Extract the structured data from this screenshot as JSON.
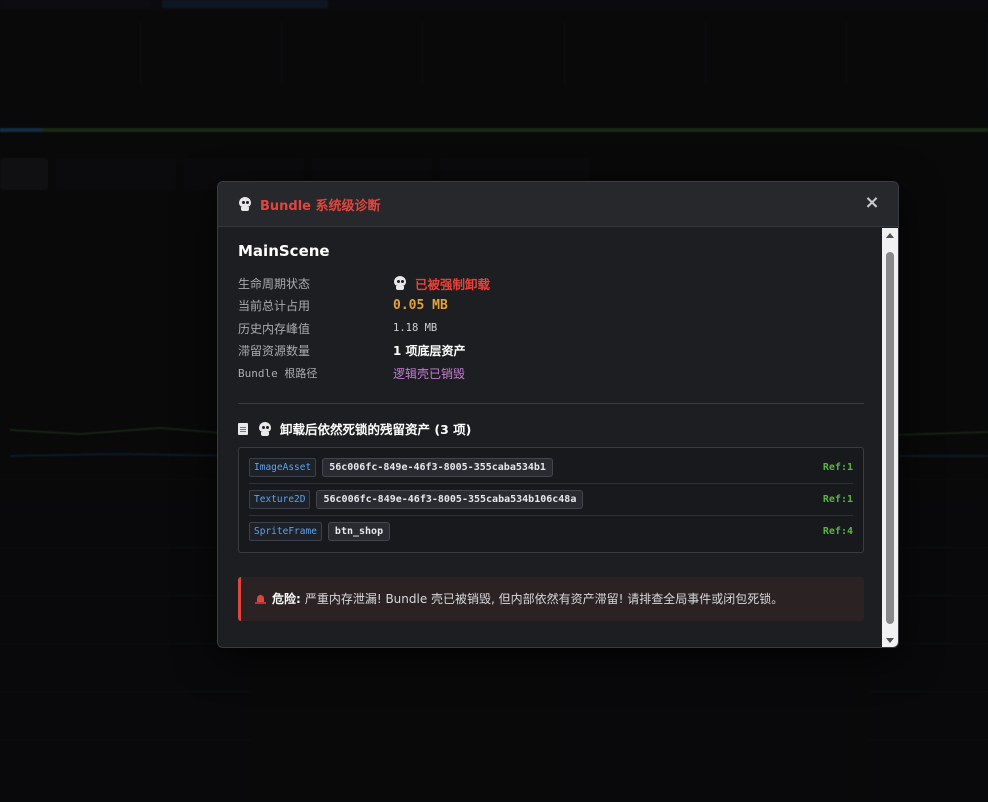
{
  "modal": {
    "title": "Bundle 系统级诊断",
    "close_icon": "×",
    "bundle_name": "MainScene",
    "info": {
      "lifecycle_label": "生命周期状态",
      "lifecycle_value": "已被强制卸载",
      "memory_label": "当前总计占用",
      "memory_value": "0.05 MB",
      "peak_label": "历史内存峰值",
      "peak_value": "1.18 MB",
      "residual_label": "滞留资源数量",
      "residual_value": "1 项底层资产",
      "root_label": "Bundle 根路径",
      "root_value": "逻辑壳已销毁"
    },
    "section_title": "卸载后依然死锁的残留资产 (3 项)",
    "assets": [
      {
        "type": "ImageAsset",
        "uuid": "56c006fc-849e-46f3-8005-355caba534b1",
        "ref": "Ref:1"
      },
      {
        "type": "Texture2D",
        "uuid": "56c006fc-849e-46f3-8005-355caba534b106c48a",
        "ref": "Ref:1"
      },
      {
        "type": "SpriteFrame",
        "uuid": "btn_shop",
        "ref": "Ref:4"
      }
    ],
    "alert": {
      "label": "危险:",
      "text": "严重内存泄漏! Bundle 壳已被销毁, 但内部依然有资产滞留! 请排查全局事件或闭包死锁。"
    }
  },
  "colors": {
    "accent_red": "#e0463e",
    "memory_orange": "#e2a33b",
    "path_purple": "#c77dd4",
    "type_blue": "#5ba3f0",
    "ref_green": "#5bb344"
  }
}
